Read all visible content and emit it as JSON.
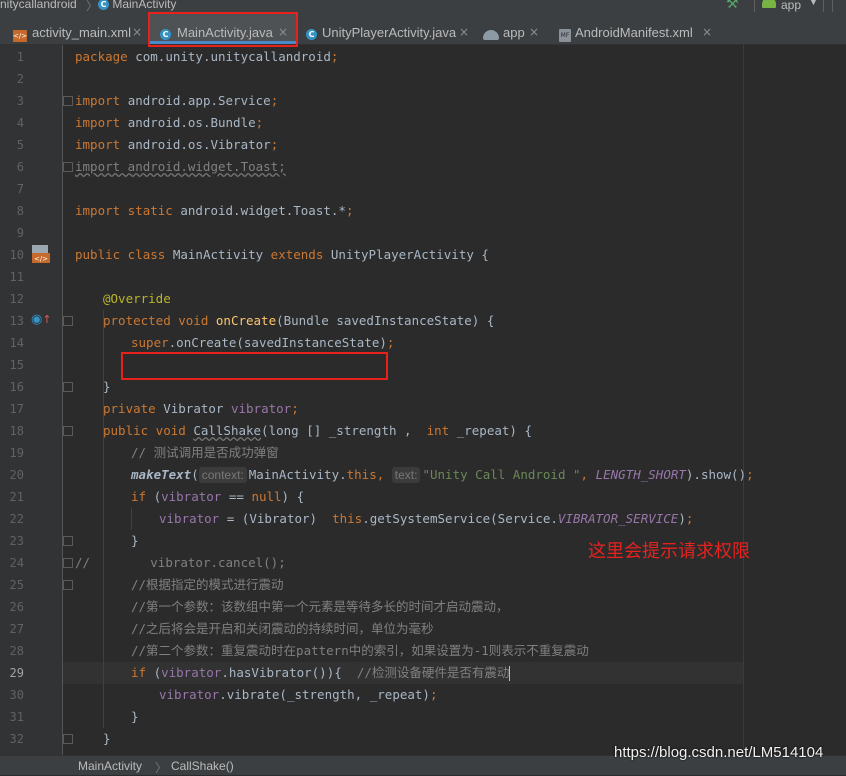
{
  "breadcrumb": {
    "module": "nitycallandroid",
    "sep": "〉",
    "file": "MainActivity"
  },
  "toolbar": {
    "run_config": "app"
  },
  "tabs": [
    {
      "label": "activity_main.xml",
      "icon": "xml-file-icon",
      "active": false
    },
    {
      "label": "MainActivity.java",
      "icon": "java-class-icon",
      "active": true
    },
    {
      "label": "UnityPlayerActivity.java",
      "icon": "java-class-icon",
      "active": false
    },
    {
      "label": "app",
      "icon": "gradle-icon",
      "active": false
    },
    {
      "label": "AndroidManifest.xml",
      "icon": "manifest-file-icon",
      "active": false
    }
  ],
  "close_glyph": "×",
  "class_icon_letter": "C",
  "editor": {
    "current_line": 29,
    "line_numbers": [
      "1",
      "2",
      "3",
      "4",
      "5",
      "6",
      "7",
      "8",
      "9",
      "10",
      "11",
      "12",
      "13",
      "14",
      "15",
      "16",
      "17",
      "18",
      "19",
      "20",
      "21",
      "22",
      "23",
      "24",
      "25",
      "26",
      "27",
      "28",
      "29",
      "30",
      "31",
      "32"
    ],
    "hints": {
      "context": "context:",
      "text": "text:"
    },
    "code_text": {
      "l1_pkg": "com.unity.unitycallandroid",
      "l3": "android.app.Service",
      "l4": "android.os.Bundle",
      "l5": "android.os.Vibrator",
      "l6": "import android.widget.Toast;",
      "l8": "android.widget.Toast.*",
      "l10_name": "MainActivity",
      "l10_parent": "UnityPlayerActivity",
      "l12": "@Override",
      "l13_fn": "onCreate",
      "l13_param": "(Bundle savedInstanceState) {",
      "l14_call": "onCreate(savedInstanceState)",
      "l17_type": "Vibrator",
      "l17_field": "vibrator",
      "l18_fn": "CallShake",
      "l18_p1": "(long [] _strength ,  ",
      "l18_p2": "_repeat) {",
      "l19": "// 测试调用是否成功弹窗",
      "l20_fn": "makeText",
      "l20_mid": "MainActivity.",
      "l20_str": "\"Unity Call Android \"",
      "l20_const": "LENGTH_SHORT",
      "l20_end": ").show()",
      "l22_cast": " = (Vibrator)  ",
      "l22_call": "getSystemService(Service.",
      "l22_const": "VIBRATOR_SERVICE",
      "l24_a": "//",
      "l24_b": "        vibrator.cancel();",
      "l25": "//根据指定的模式进行震动",
      "l26": "//第一个参数：该数组中第一个元素是等待多长的时间才启动震动，",
      "l27": "//之后将会是开启和关闭震动的持续时间，单位为毫秒",
      "l28": "//第二个参数：重复震动时在pattern中的索引，如果设置为-1则表示不重复震动",
      "l29_call": "hasVibrator()",
      "l29_cmt": "//检测设备硬件是否有震动",
      "l30_call": "vibrate(_strength, _repeat)"
    }
  },
  "annotation": "这里会提示请求权限",
  "status_breadcrumb": {
    "class": "MainActivity",
    "sep": "〉",
    "method": "CallShake()"
  },
  "watermark": "https://blog.csdn.net/LM514104",
  "colors": {
    "keyword": "#cc7832",
    "string": "#6a8759",
    "comment": "#808080",
    "field": "#9876aa",
    "method": "#ffc66d",
    "annotation": "#bbb529",
    "highlight": "#e8211d"
  }
}
